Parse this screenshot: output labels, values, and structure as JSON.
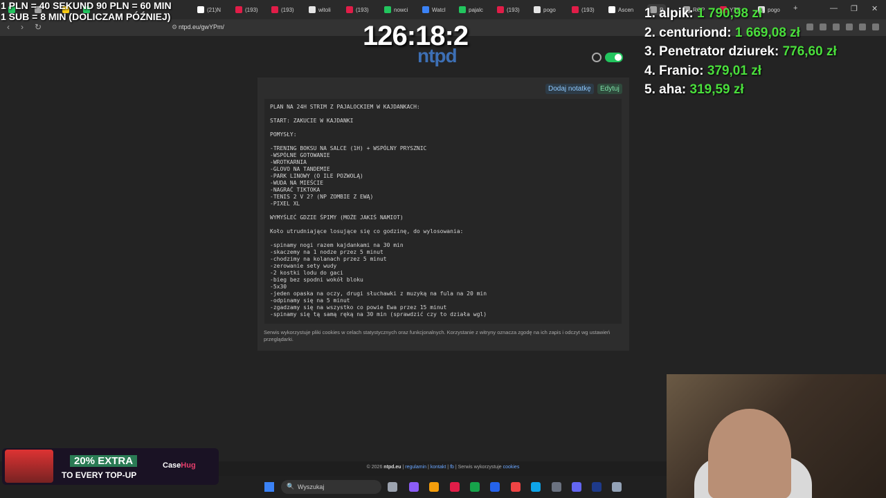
{
  "browser": {
    "tabs": [
      {
        "label": "",
        "color": "#22c55e"
      },
      {
        "label": "",
        "color": "#a3a3a3"
      },
      {
        "label": "",
        "color": "#facc15"
      },
      {
        "label": "",
        "color": "#22c55e"
      },
      {
        "label": "(21)N",
        "color": "#ffffff"
      },
      {
        "label": "(193)",
        "color": "#e11d48"
      },
      {
        "label": "(193)",
        "color": "#e11d48"
      },
      {
        "label": "witoli",
        "color": "#e5e5e5"
      },
      {
        "label": "(193)",
        "color": "#e11d48"
      },
      {
        "label": "nowci",
        "color": "#22c55e"
      },
      {
        "label": "Watcl",
        "color": "#3b82f6"
      },
      {
        "label": "pajalc",
        "color": "#22c55e"
      },
      {
        "label": "(193)",
        "color": "#e11d48"
      },
      {
        "label": "pogo",
        "color": "#e5e5e5"
      },
      {
        "label": "(193)",
        "color": "#e11d48"
      },
      {
        "label": "Ascen",
        "color": "#ffffff"
      },
      {
        "label": "P",
        "color": "#a3a3a3"
      },
      {
        "label": "ROP",
        "color": "#a3a3a3"
      },
      {
        "label": "YTR",
        "color": "#e11d48"
      },
      {
        "label": "pogo",
        "color": "#e5e5e5"
      }
    ],
    "new_tab": "+",
    "minimize": "—",
    "maximize": "❐",
    "close": "✕",
    "back": "‹",
    "forward": "›",
    "reload": "↻",
    "url": "ntpd.eu/gwYPm/"
  },
  "overlay": {
    "rate_line1": "1 PLN =  40 SEKUND 90 PLN = 60 MIN",
    "rate_line2": "1 SUB = 8 MIN (DOLICZAM PÓŹNIEJ)",
    "timer": "126:18:2",
    "leaderboard": [
      {
        "rank": "1.",
        "name": "alpik:",
        "amount": "1 790,98 zł"
      },
      {
        "rank": "2.",
        "name": "centuriond:",
        "amount": "1 669,08 zł"
      },
      {
        "rank": "3.",
        "name": "Penetrator dziurek:",
        "amount": "776,60 zł"
      },
      {
        "rank": "4.",
        "name": "Franio:",
        "amount": "379,01 zł"
      },
      {
        "rank": "5.",
        "name": "aha:",
        "amount": "319,59 zł"
      }
    ],
    "promo_line1": "20% EXTRA",
    "promo_line2": "TO EVERY TOP-UP",
    "promo_brand_a": "Case",
    "promo_brand_b": "Hug"
  },
  "page": {
    "logo": "ntpd",
    "add_note_label": "Dodaj notatkę",
    "edit_label": "Edytuj",
    "note_text": "PLAN NA 24H STRIM Z PAJALOCKIEM W KAJDANKACH:\n\nSTART: ZAKUCIE W KAJDANKI\n\nPOMYSŁY:\n\n-TRENING BOKSU NA SALCE (1H) + WSPÓLNY PRYSZNIC\n-WSPÓLNE GOTOWANIE\n-WROTKARNIA\n-GLOVO NA TANDEMIE\n-PARK LINOWY (O ILE POZWOLĄ)\n-WUDA NA MIEŚCIE\n-NAGRAĆ TIKTOKA\n-TENIS 2 V 2? (NP ZOMBIE Z EWĄ)\n-PIXEL XL\n\nWYMYŚLEĆ GDZIE ŚPIMY (MOŻE JAKIŚ NAMIOT)\n\nKoło utrudniające losujące się co godzinę, do wylosowania:\n\n-spinamy nogi razem kajdankami na 30 min\n-skaczemy na 1 nodze przez 5 minut\n-chodzimy na kolanach przez 5 minut\n-zerowanie sety wudy\n-2 kostki lodu do gaci\n-bieg bez spodni wokół bloku\n-5x30\n-jeden opaska na oczy, drugi słuchawki z muzyką na fula na 20 min\n-odpinamy się na 5 minut\n-zgadzamy się na wszystko co powie Ewa przez 15 minut\n-spinamy się tą samą ręką na 30 min (sprawdzić czy to działa wgl)",
    "cookie_notice": "Serwis wykorzystuje pliki cookies w celach statystycznych oraz funkcjonalnych. Korzystanie z witryny oznacza zgodę na ich zapis i odczyt wg ustawień przeglądarki.",
    "footer": {
      "copyright": "© 2026 ",
      "site": "ntpd.eu",
      "sep": " | ",
      "regulamin": "regulamin",
      "kontakt": "kontakt",
      "fb": "fb",
      "cookies_text": "Serwis wykorzystuje ",
      "cookies_link": "cookies"
    }
  },
  "taskbar": {
    "search_placeholder": "Wyszukaj",
    "icons": [
      "#9ca3af",
      "#8b5cf6",
      "#f59e0b",
      "#e11d48",
      "#16a34a",
      "#2563eb",
      "#ef4444",
      "#0ea5e9",
      "#6b7280",
      "#6366f1",
      "#1e3a8a",
      "#94a3b8"
    ]
  }
}
